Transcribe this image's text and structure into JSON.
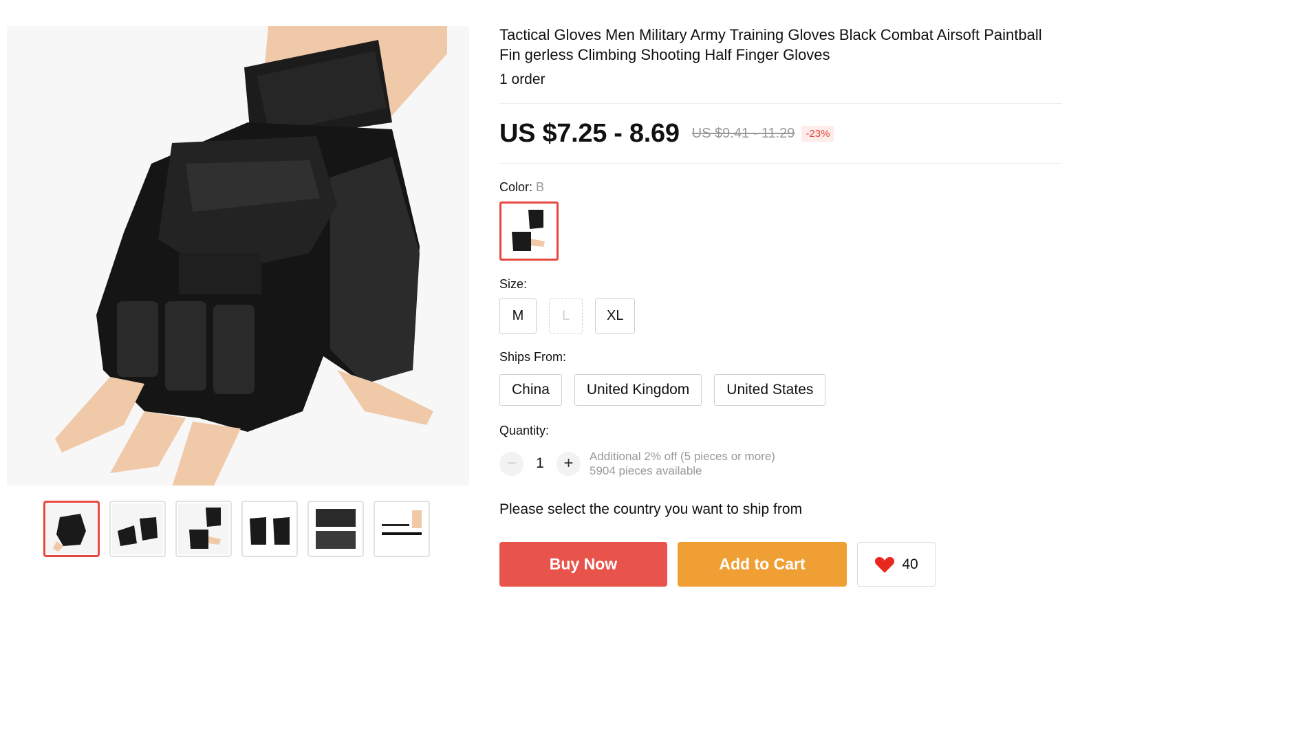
{
  "product": {
    "title": "Tactical Gloves Men Military Army Training Gloves Black Combat Airsoft Paintball Fin gerless Climbing Shooting Half Finger Gloves",
    "orders": "1 order"
  },
  "price": {
    "current": "US $7.25 - 8.69",
    "original": "US $9.41 - 11.29",
    "discount": "-23%"
  },
  "color": {
    "label": "Color:",
    "selected": "B"
  },
  "size": {
    "label": "Size:",
    "options": [
      "M",
      "L",
      "XL"
    ],
    "disabled": [
      "L"
    ]
  },
  "ships_from": {
    "label": "Ships From:",
    "options": [
      "China",
      "United Kingdom",
      "United States"
    ]
  },
  "quantity": {
    "label": "Quantity:",
    "value": "1",
    "minus": "−",
    "plus": "+",
    "discount_note": "Additional 2% off (5 pieces or more)",
    "available": "5904 pieces available"
  },
  "ship_prompt": "Please select the country you want to ship from",
  "actions": {
    "buy_now": "Buy Now",
    "add_to_cart": "Add to Cart",
    "wishlist_count": "40"
  },
  "colors": {
    "accent": "#e8473f",
    "buy": "#e8544c",
    "cart": "#f09f34"
  },
  "icons": {
    "wishlist": "heart-icon"
  }
}
